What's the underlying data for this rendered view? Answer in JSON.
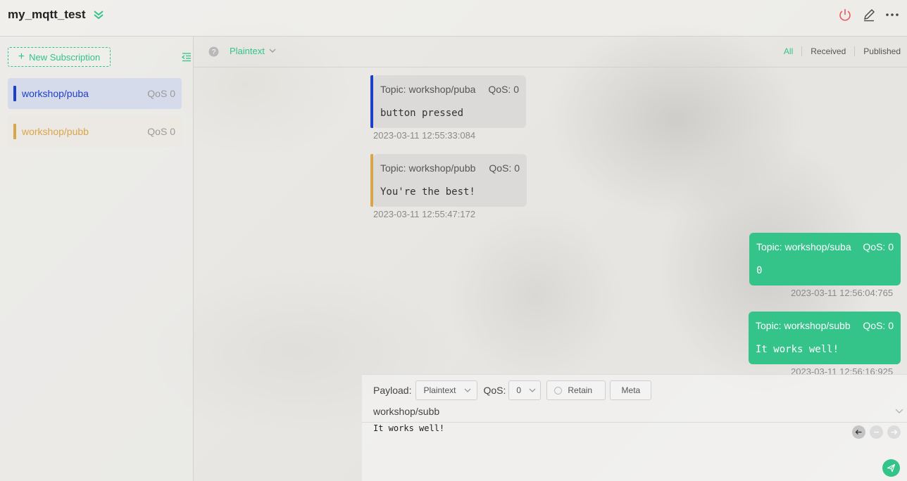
{
  "header": {
    "connection_name": "my_mqtt_test"
  },
  "sidebar": {
    "new_subscription_label": "New Subscription",
    "subscriptions": [
      {
        "topic": "workshop/puba",
        "qos": "QoS 0",
        "color": "#1e40c8"
      },
      {
        "topic": "workshop/pubb",
        "qos": "QoS 0",
        "color": "#d8a64a"
      }
    ]
  },
  "toolbar": {
    "payload_format": "Plaintext",
    "filters": [
      "All",
      "Received",
      "Published"
    ],
    "active_filter": "All"
  },
  "messages": [
    {
      "direction": "received",
      "topic": "Topic: workshop/puba",
      "qos": "QoS: 0",
      "payload": "button pressed",
      "timestamp": "2023-03-11 12:55:33:084",
      "color": "#1e40c8"
    },
    {
      "direction": "received",
      "topic": "Topic: workshop/pubb",
      "qos": "QoS: 0",
      "payload": "You're the best!",
      "timestamp": "2023-03-11 12:55:47:172",
      "color": "#d8a64a"
    },
    {
      "direction": "published",
      "topic": "Topic: workshop/suba",
      "qos": "QoS: 0",
      "payload": "0",
      "timestamp": "2023-03-11 12:56:04:765"
    },
    {
      "direction": "published",
      "topic": "Topic: workshop/subb",
      "qos": "QoS: 0",
      "payload": "It works well!",
      "timestamp": "2023-03-11 12:56:16:925"
    }
  ],
  "publish": {
    "payload_label": "Payload:",
    "payload_format": "Plaintext",
    "qos_label": "QoS:",
    "qos_value": "0",
    "retain_label": "Retain",
    "meta_label": "Meta",
    "topic": "workshop/subb",
    "body": "It works well!"
  },
  "colors": {
    "accent": "#34c388",
    "disconnect": "#e85a5a"
  }
}
